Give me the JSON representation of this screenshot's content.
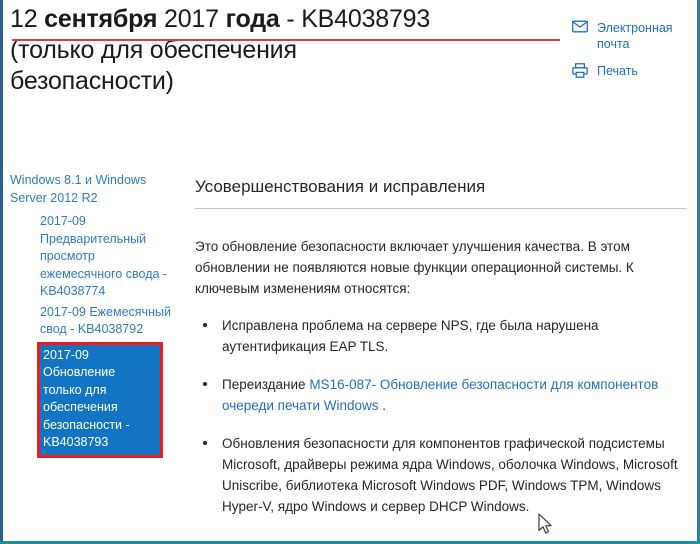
{
  "page": {
    "title_line1_part1": "12 ",
    "title_line1_bold1": "сентября",
    "title_line1_part2": " 2017 ",
    "title_line1_bold2": "года",
    "title_line1_part3": " - KB4038793",
    "title_line2": "(только для обеспечения",
    "title_line3": "безопасности)",
    "accent_red": "#e03a3a",
    "link_blue": "#1f6fc4",
    "selected_blue": "#1474c4",
    "highlight_red": "#ee1c1c"
  },
  "header_actions": [
    {
      "icon": "envelope-icon",
      "label": "Электронная почта"
    },
    {
      "icon": "printer-icon",
      "label": "Печать"
    }
  ],
  "sidebar": {
    "root_label": "Windows 8.1 и Windows Server 2012 R2",
    "items": [
      {
        "label": "2017-09 Предварительный просмотр ежемесячного свода - KB4038774",
        "selected": false
      },
      {
        "label": "2017-09 Ежемесячный свод - KB4038792",
        "selected": false
      },
      {
        "label": "2017-09 Обновление только для обеспечения безопасности - KB4038793",
        "selected": true
      }
    ]
  },
  "content": {
    "heading": "Усовершенствования и исправления",
    "intro": "Это обновление безопасности включает улучшения качества. В этом обновлении не появляются новые функции операционной системы. К ключевым изменениям относятся:",
    "bullets": [
      {
        "pre": "Исправлена проблема на сервере NPS, где была нарушена аутентификация EAP TLS.",
        "link": "",
        "post": ""
      },
      {
        "pre": "Переиздание ",
        "link": "MS16-087- Обновление безопасности для компонентов очереди печати Windows",
        "post": " ."
      },
      {
        "pre": "Обновления безопасности для компонентов графической подсистемы Microsoft, драйверы режима ядра Windows, оболочка Windows, Microsoft Uniscribe, библиотека Microsoft Windows PDF, Windows TPM, Windows Hyper-V, ядро Windows и сервер DHCP Windows.",
        "link": "",
        "post": ""
      }
    ]
  }
}
